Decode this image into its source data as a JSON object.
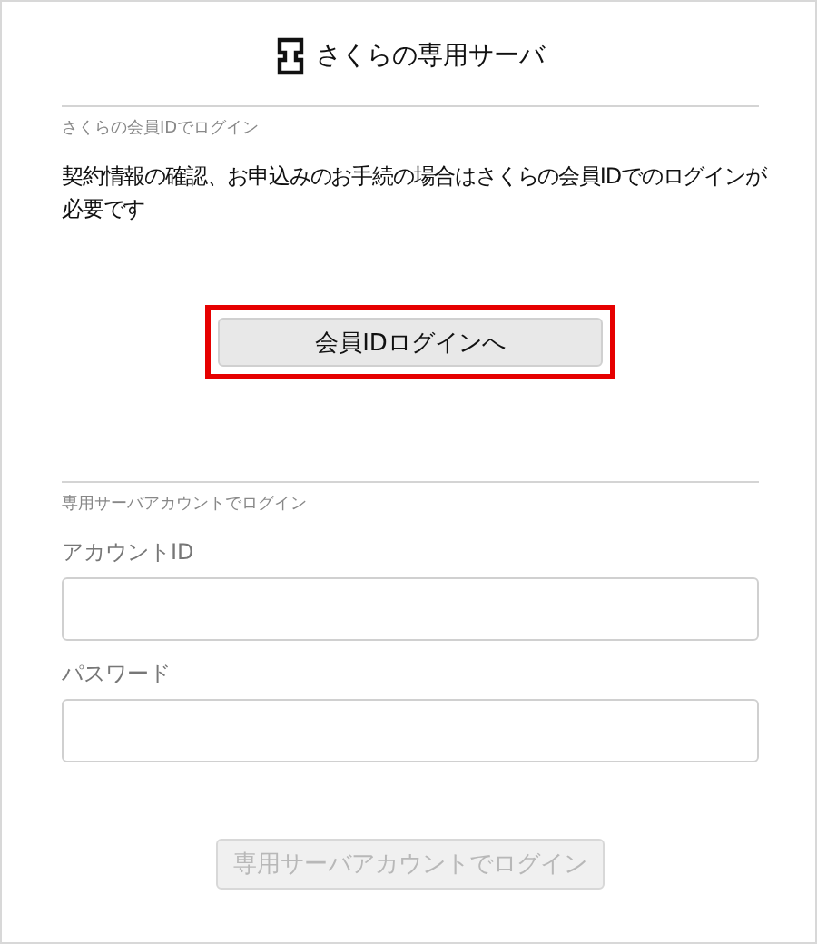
{
  "logo": {
    "text": "さくらの専用サーバ"
  },
  "member_login": {
    "heading": "さくらの会員IDでログイン",
    "description": "契約情報の確認、お申込みのお手続の場合はさくらの会員IDでのログインが必要です",
    "button": {
      "label": "会員IDログインへ",
      "highlighted": true
    }
  },
  "account_login": {
    "heading": "専用サーバアカウントでログイン",
    "fields": [
      {
        "label": "アカウントID"
      },
      {
        "label": "パスワード"
      }
    ],
    "button": {
      "label": "専用サーバアカウントでログイン",
      "disabled": true
    }
  }
}
